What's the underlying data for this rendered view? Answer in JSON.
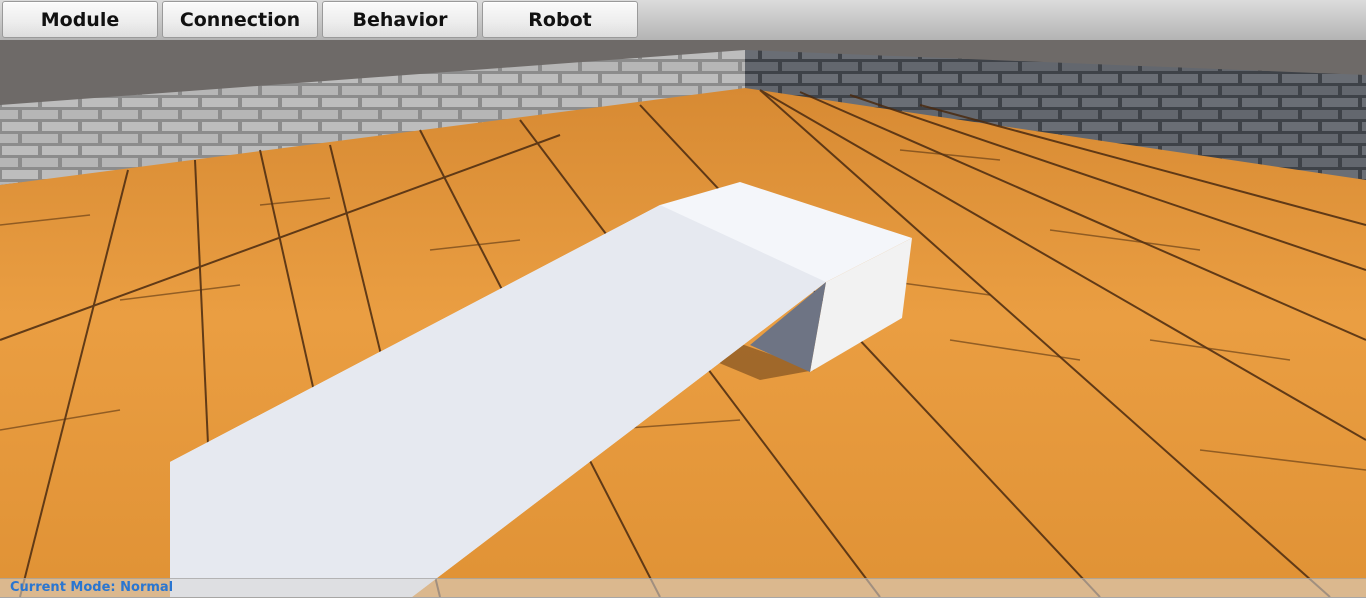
{
  "toolbar": {
    "buttons": [
      {
        "label": "Module"
      },
      {
        "label": "Connection"
      },
      {
        "label": "Behavior"
      },
      {
        "label": "Robot"
      }
    ]
  },
  "status_bar": {
    "mode_text": "Current Mode: Normal"
  },
  "colors": {
    "mode_text": "#2a76d1",
    "floor": "#e59a3a",
    "module_block": "#ffffff"
  }
}
